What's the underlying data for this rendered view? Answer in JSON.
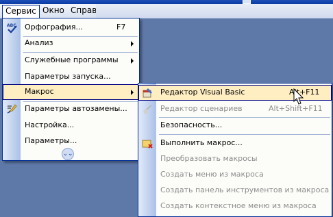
{
  "menubar": {
    "items": [
      {
        "label": "Сервис",
        "open": true
      },
      {
        "label": "Окно"
      },
      {
        "label": "Справка"
      }
    ]
  },
  "service_menu": {
    "items": [
      {
        "label": "Орфография...",
        "shortcut": "F7",
        "icon": "spelling-abc-check-icon"
      },
      {
        "label": "Анализ",
        "submenu": true
      },
      {
        "label": "Служебные программы",
        "submenu": true
      },
      {
        "label": "Параметры запуска..."
      },
      {
        "label": "Макрос",
        "submenu": true,
        "highlighted": true
      },
      {
        "label": "Параметры автозамены...",
        "icon": "autocorrect-icon"
      },
      {
        "label": "Настройка..."
      },
      {
        "label": "Параметры..."
      }
    ],
    "expand_icon": "double-chevron-down-icon"
  },
  "macro_menu": {
    "items": [
      {
        "label": "Редактор Visual Basic",
        "shortcut": "Alt+F11",
        "icon": "visual-basic-editor-icon",
        "highlighted": true
      },
      {
        "label": "Редактор сценариев",
        "shortcut": "Alt+Shift+F11",
        "icon": "script-editor-icon",
        "disabled": true
      },
      {
        "label": "Безопасность..."
      },
      {
        "label": "Выполнить макрос...",
        "icon": "run-macro-icon"
      },
      {
        "label": "Преобразовать макросы",
        "disabled": true
      },
      {
        "label": "Создать меню из макроса",
        "disabled": true
      },
      {
        "label": "Создать панель инструментов из макроса",
        "disabled": true
      },
      {
        "label": "Создать контекстное меню из макроса",
        "disabled": true
      }
    ]
  }
}
